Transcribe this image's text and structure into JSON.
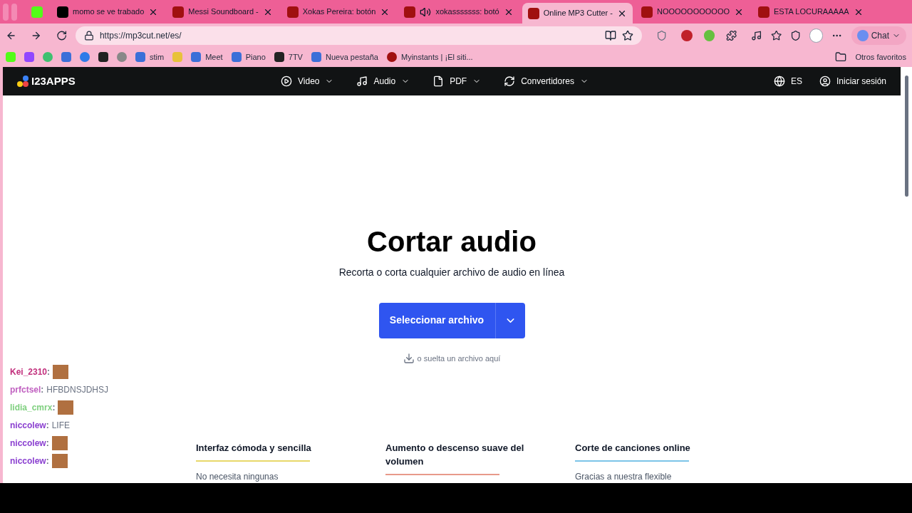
{
  "tabs": [
    {
      "selected": false,
      "closable": false,
      "audio": false
    },
    {
      "title": "momo se ve trabado",
      "selected": false,
      "closable": true,
      "audio": false
    },
    {
      "title": "Messi Soundboard -",
      "selected": false,
      "closable": true,
      "audio": false
    },
    {
      "title": "Xokas Pereira: botón",
      "selected": false,
      "closable": true,
      "audio": false
    },
    {
      "title": "xokasssssss: botó",
      "selected": false,
      "closable": true,
      "audio": true
    },
    {
      "title": "Online MP3 Cutter -",
      "selected": true,
      "closable": true,
      "audio": false
    },
    {
      "title": "NOOOOOOOOOOO",
      "selected": false,
      "closable": true,
      "audio": false
    },
    {
      "title": "ESTA LOCURAAAAA",
      "selected": false,
      "closable": true,
      "audio": false
    }
  ],
  "address": "https://mp3cut.net/es/",
  "chat_button": "Chat",
  "bookmarks": [
    {
      "kind": "kick"
    },
    {
      "kind": "twitch"
    },
    {
      "kind": "green"
    },
    {
      "kind": "docs"
    },
    {
      "kind": "circle"
    },
    {
      "kind": "dark"
    },
    {
      "kind": "gpt"
    },
    {
      "kind": "plain",
      "label": "stim"
    },
    {
      "kind": "classroom"
    },
    {
      "kind": "plain",
      "label": "Meet"
    },
    {
      "kind": "plain",
      "label": "Piano"
    },
    {
      "kind": "dark",
      "label": "7TV"
    },
    {
      "kind": "plain",
      "label": "Nueva pestaña"
    },
    {
      "kind": "red",
      "label": "Myinstants | ¡El siti..."
    }
  ],
  "other_bookmarks": "Otros favoritos",
  "site": {
    "logo": "I23APPS",
    "nav": [
      "Video",
      "Audio",
      "PDF",
      "Convertidores"
    ],
    "language": "ES",
    "login": "Iniciar sesión"
  },
  "hero": {
    "title": "Cortar audio",
    "subtitle": "Recorta o corta cualquier archivo de audio en línea",
    "button": "Seleccionar archivo",
    "drop_hint": "o suelta un archivo aquí"
  },
  "features": [
    {
      "title": "Interfaz cómoda y sencilla",
      "body": "No necesita ningunas",
      "color": "#e8d86a"
    },
    {
      "title": "Aumento o descenso suave del volumen",
      "color": "#e89a8a"
    },
    {
      "title": "Corte de canciones online",
      "body": "Gracias a nuestra flexible",
      "color": "#7cc4e8"
    }
  ],
  "chat": [
    {
      "user": "Kei_2310",
      "separator": ":",
      "color": "#c2307d",
      "kind": "emote"
    },
    {
      "user": "prfctsel",
      "separator": ":",
      "color": "#c060c0",
      "kind": "text",
      "text": "HFBDNSJDHSJ"
    },
    {
      "user": "lidia_cmrx",
      "separator": ":",
      "color": "#80d080",
      "kind": "emote"
    },
    {
      "user": "niccolew",
      "separator": ":",
      "color": "#8a3fd0",
      "kind": "text",
      "text": "LIFE"
    },
    {
      "user": "niccolew",
      "separator": ":",
      "color": "#8a3fd0",
      "kind": "emote"
    },
    {
      "user": "niccolew",
      "separator": ":",
      "color": "#8a3fd0",
      "kind": "emote"
    }
  ]
}
